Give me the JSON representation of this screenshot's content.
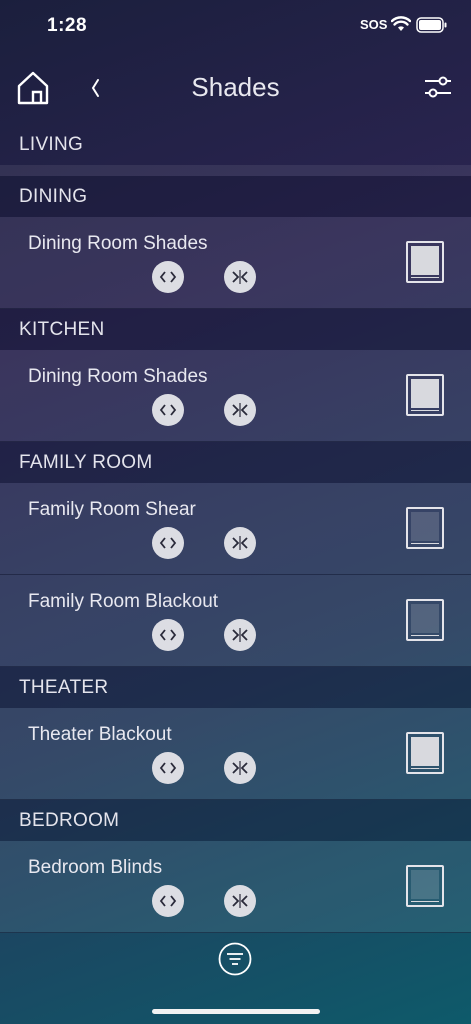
{
  "status": {
    "time": "1:28",
    "sos": "SOS"
  },
  "nav": {
    "title": "Shades"
  },
  "sections": [
    {
      "name": "LIVING",
      "items": []
    },
    {
      "name": "DINING",
      "items": [
        {
          "label": "Dining Room Shades",
          "state": "closed"
        }
      ]
    },
    {
      "name": "KITCHEN",
      "items": [
        {
          "label": "Dining Room Shades",
          "state": "closed"
        }
      ]
    },
    {
      "name": "FAMILY ROOM",
      "items": [
        {
          "label": "Family Room Shear",
          "state": "open"
        },
        {
          "label": "Family Room Blackout",
          "state": "open"
        }
      ]
    },
    {
      "name": "THEATER",
      "items": [
        {
          "label": "Theater Blackout",
          "state": "closed"
        }
      ]
    },
    {
      "name": "BEDROOM",
      "items": [
        {
          "label": "Bedroom Blinds",
          "state": "open"
        }
      ]
    }
  ],
  "icons": {
    "home": "home-icon",
    "back": "chevron-left-icon",
    "settings": "sliders-icon",
    "open": "chevrons-apart-icon",
    "close": "chevrons-together-icon",
    "filter": "filter-icon"
  },
  "colors": {
    "button": "#dcdde3",
    "text": "#e8e8f0"
  }
}
